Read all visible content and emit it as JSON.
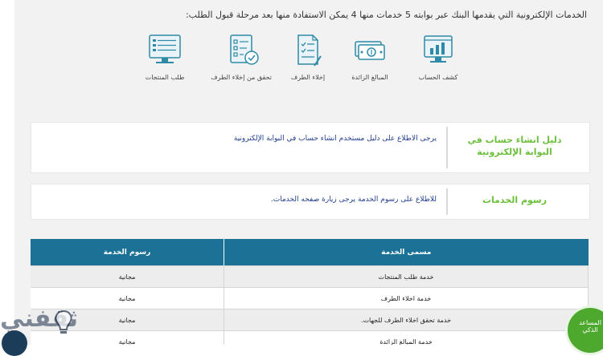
{
  "intro_text": "الخدمات الإلكترونية التي يقدمها البنك عبر بوابته   5 خدمات منها 4 يمكن الاستفادة منها بعد مرحلة قبول الطلب:",
  "services": [
    {
      "label": "كشف الحساب",
      "icon": "account-statement-icon"
    },
    {
      "label": "المبالغ الزائدة",
      "icon": "cash-icon"
    },
    {
      "label": "إخلاء الطرف",
      "icon": "clearance-document-icon"
    },
    {
      "label": "تحقق من إخلاء الطرف",
      "icon": "verify-checklist-icon"
    },
    {
      "label": "طلب المنتجات",
      "icon": "products-monitor-icon"
    }
  ],
  "guide_card": {
    "title": "دليل انشاء حساب في البوابة الإلكترونية",
    "link": "يرجى الاطلاع على دليل مستخدم انشاء حساب في البوابة الإلكترونية"
  },
  "fees_card": {
    "title": "رسوم الخدمات",
    "link": "للاطلاع على رسوم الخدمة يرجى زيارة صفحه الخدمات."
  },
  "fees_table": {
    "headers": [
      "مسمى الخدمة",
      "رسوم الخدمة"
    ],
    "rows": [
      [
        "خدمة طلب المنتجات",
        "مجانية"
      ],
      [
        "خدمة اخلاء الطرف",
        "مجانية"
      ],
      [
        "خدمة تحقق اخلاء الطرف للجهات.",
        "مجانية"
      ],
      [
        "خدمة المبالغ الزائدة",
        "مجانية"
      ]
    ]
  },
  "assistant": {
    "line1": "المساعد",
    "line2": "الذكي"
  },
  "watermark": {
    "text": "ثقفني",
    "icon": "lightbulb-icon"
  },
  "colors": {
    "accent_green": "#6cbf3b",
    "table_header": "#1b7196",
    "icon_teal": "#2e8aa6",
    "link_blue": "#1f3d8c"
  }
}
